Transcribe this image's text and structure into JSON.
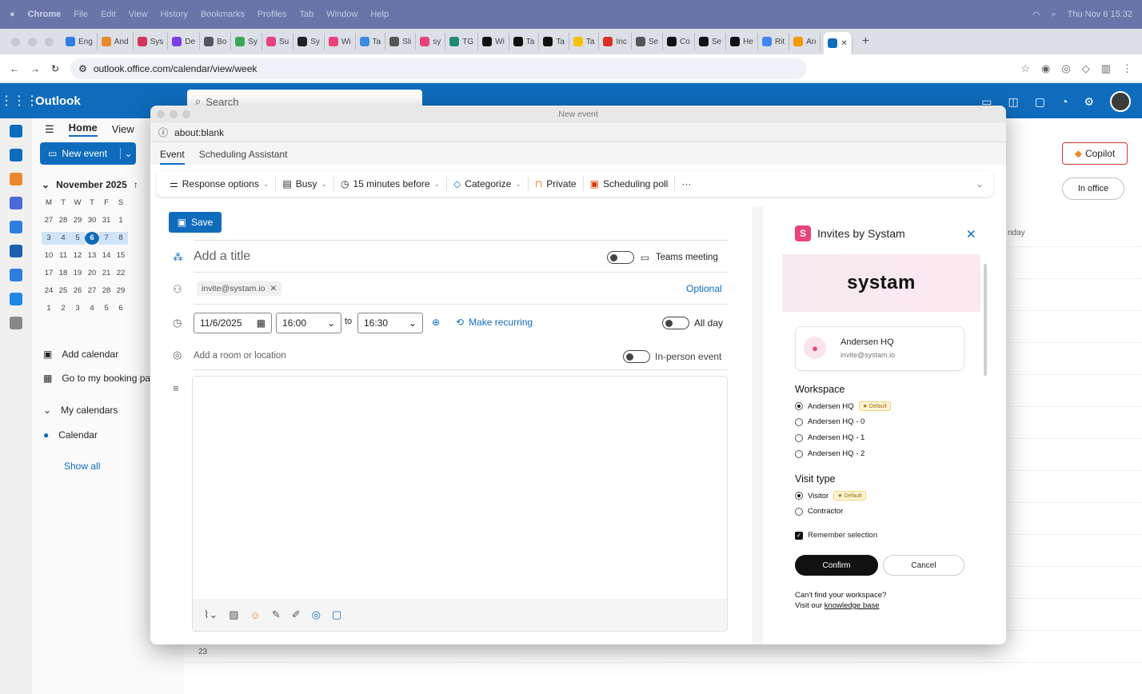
{
  "mac_menu": {
    "apple": "",
    "items": [
      "Chrome",
      "File",
      "Edit",
      "View",
      "History",
      "Bookmarks",
      "Profiles",
      "Tab",
      "Window",
      "Help"
    ],
    "clock": "Thu Nov 6  15:32"
  },
  "browser_tabs": [
    {
      "label": "Eng",
      "color": "#2f7de1"
    },
    {
      "label": "And",
      "color": "#e9892b"
    },
    {
      "label": "Sys",
      "color": "#d1365c"
    },
    {
      "label": "De",
      "color": "#7b3fe4"
    },
    {
      "label": "Bo",
      "color": "#555555"
    },
    {
      "label": "Sy",
      "color": "#3aa757"
    },
    {
      "label": "Su",
      "color": "#e8437a"
    },
    {
      "label": "Sy",
      "color": "#222222"
    },
    {
      "label": "Wi",
      "color": "#e8437a"
    },
    {
      "label": "Ta",
      "color": "#3a8dde"
    },
    {
      "label": "Sli",
      "color": "#555555"
    },
    {
      "label": "sy",
      "color": "#e8437a"
    },
    {
      "label": "TG",
      "color": "#1f8a70"
    },
    {
      "label": "Wi",
      "color": "#111111"
    },
    {
      "label": "Ta",
      "color": "#111111"
    },
    {
      "label": "Ta",
      "color": "#111111"
    },
    {
      "label": "Ta",
      "color": "#f4c20d"
    },
    {
      "label": "Inc",
      "color": "#d93025"
    },
    {
      "label": "Se",
      "color": "#555555"
    },
    {
      "label": "Co",
      "color": "#111111"
    },
    {
      "label": "Se",
      "color": "#111111"
    },
    {
      "label": "He",
      "color": "#111111"
    },
    {
      "label": "Rit",
      "color": "#4285f4"
    },
    {
      "label": "An",
      "color": "#f29900"
    }
  ],
  "address": {
    "url": "outlook.office.com/calendar/view/week"
  },
  "outlook": {
    "brand": "Outlook",
    "search_placeholder": "Search",
    "ribbon_tabs": {
      "home": "Home",
      "view": "View"
    },
    "new_event": "New event",
    "copilot": "Copilot",
    "in_office": "In office",
    "day_label": "nday",
    "time_23": "23"
  },
  "mini_calendar": {
    "month": "November 2025",
    "weekdays": [
      "M",
      "T",
      "W",
      "T",
      "F",
      "S",
      ""
    ],
    "weeks": [
      [
        "27",
        "28",
        "29",
        "30",
        "31",
        "1",
        ""
      ],
      [
        "3",
        "4",
        "5",
        "6",
        "7",
        "8",
        ""
      ],
      [
        "10",
        "11",
        "12",
        "13",
        "14",
        "15",
        ""
      ],
      [
        "17",
        "18",
        "19",
        "20",
        "21",
        "22",
        ""
      ],
      [
        "24",
        "25",
        "26",
        "27",
        "28",
        "29",
        ""
      ],
      [
        "1",
        "2",
        "3",
        "4",
        "5",
        "6",
        ""
      ]
    ],
    "today": "6"
  },
  "left_links": {
    "add_calendar": "Add calendar",
    "booking": "Go to my booking pa",
    "my_calendars": "My calendars",
    "calendar": "Calendar",
    "show_all": "Show all"
  },
  "dialog": {
    "window_title": "New event",
    "url": "about:blank",
    "tabs": {
      "event": "Event",
      "scheduling": "Scheduling Assistant"
    },
    "toolbar": {
      "response": "Response options",
      "busy": "Busy",
      "reminder": "15 minutes before",
      "categorize": "Categorize",
      "private": "Private",
      "poll": "Scheduling poll",
      "more": "···"
    },
    "save": "Save",
    "title_placeholder": "Add a title",
    "teams": "Teams meeting",
    "attendee": "invite@systam.io",
    "optional": "Optional",
    "date": "11/6/2025",
    "start": "16:00",
    "to": "to",
    "end": "16:30",
    "recurring": "Make recurring",
    "all_day": "All day",
    "location_placeholder": "Add a room or location",
    "in_person": "In-person event"
  },
  "panel": {
    "title": "Invites by Systam",
    "banner": "systam",
    "org_name": "Andersen HQ",
    "org_email": "invite@systam.io",
    "workspace_label": "Workspace",
    "workspaces": [
      "Andersen HQ",
      "Andersen HQ - 0",
      "Andersen HQ - 1",
      "Andersen HQ - 2"
    ],
    "default_badge": "Default",
    "visit_label": "Visit type",
    "visit_types": [
      "Visitor",
      "Contractor"
    ],
    "remember": "Remember selection",
    "confirm": "Confirm",
    "cancel": "Cancel",
    "footer_1": "Can't find your workspace?",
    "footer_2": "Visit our",
    "footer_link": "knowledge base"
  },
  "colors": {
    "brand_blue": "#0f6cbd",
    "systam_pink": "#e8437a"
  }
}
